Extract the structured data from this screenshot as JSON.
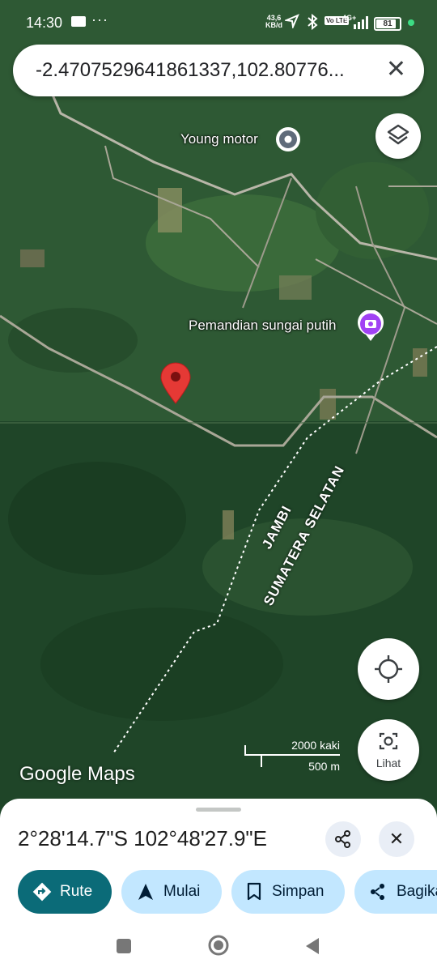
{
  "status_bar": {
    "time": "14:30",
    "net_speed_value": "43,6",
    "net_speed_unit": "KB/d",
    "volte": "Vo LTE",
    "network": "4G+",
    "battery": "81",
    "battery_level": 0.81
  },
  "search": {
    "query": "-2.4707529641861337,102.80776..."
  },
  "map": {
    "places": [
      {
        "name": "Young motor"
      },
      {
        "name": "Pemandian sungai putih"
      }
    ],
    "region_labels": [
      "JAMBI",
      "SUMATERA SELATAN"
    ],
    "scale_imperial": "2000 kaki",
    "scale_metric": "500 m",
    "watermark": "Google Maps",
    "lens_label": "Lihat",
    "colors": {
      "pin": "#e53935",
      "poi": "#a142f4"
    }
  },
  "sheet": {
    "coordinates": "2°28'14.7\"S 102°48'27.9\"E",
    "actions": [
      {
        "label": "Rute",
        "icon": "directions-icon"
      },
      {
        "label": "Mulai",
        "icon": "navigation-icon"
      },
      {
        "label": "Simpan",
        "icon": "bookmark-icon"
      },
      {
        "label": "Bagikan",
        "icon": "share-icon"
      }
    ]
  }
}
